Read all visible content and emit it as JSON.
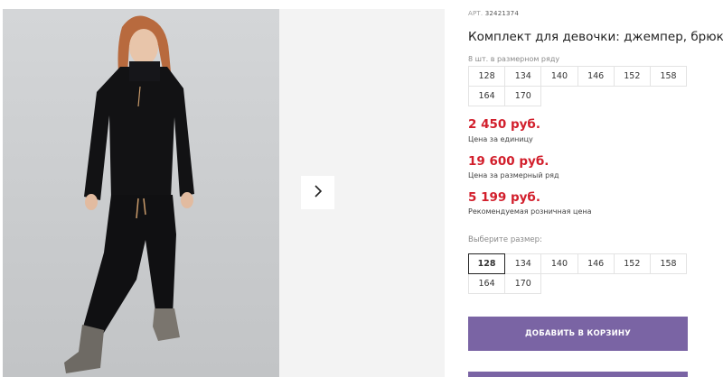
{
  "product": {
    "art_label": "АРТ.",
    "art_number": "32421374",
    "title": "Комплект для девочки: джемпер, брюки",
    "set_note": "8 шт. в размерном ряду",
    "set_sizes_row1": [
      "128",
      "134",
      "140",
      "146",
      "152",
      "158"
    ],
    "set_sizes_row2": [
      "164",
      "170"
    ],
    "prices": [
      {
        "value": "2 450 руб.",
        "label": "Цена за единицу"
      },
      {
        "value": "19 600 руб.",
        "label": "Цена за размерный ряд"
      },
      {
        "value": "5 199 руб.",
        "label": "Рекомендуемая розничная цена"
      }
    ],
    "choose_label": "Выберите размер:",
    "choose_sizes_row1": [
      "128",
      "134",
      "140",
      "146",
      "152",
      "158"
    ],
    "choose_sizes_row2": [
      "164",
      "170"
    ],
    "selected_size": "128",
    "add_to_cart": "ДОБАВИТЬ В КОРЗИНУ"
  },
  "colors": {
    "price": "#d21f2c",
    "button": "#7a64a4"
  },
  "icons": {
    "next": "chevron-right-icon"
  }
}
